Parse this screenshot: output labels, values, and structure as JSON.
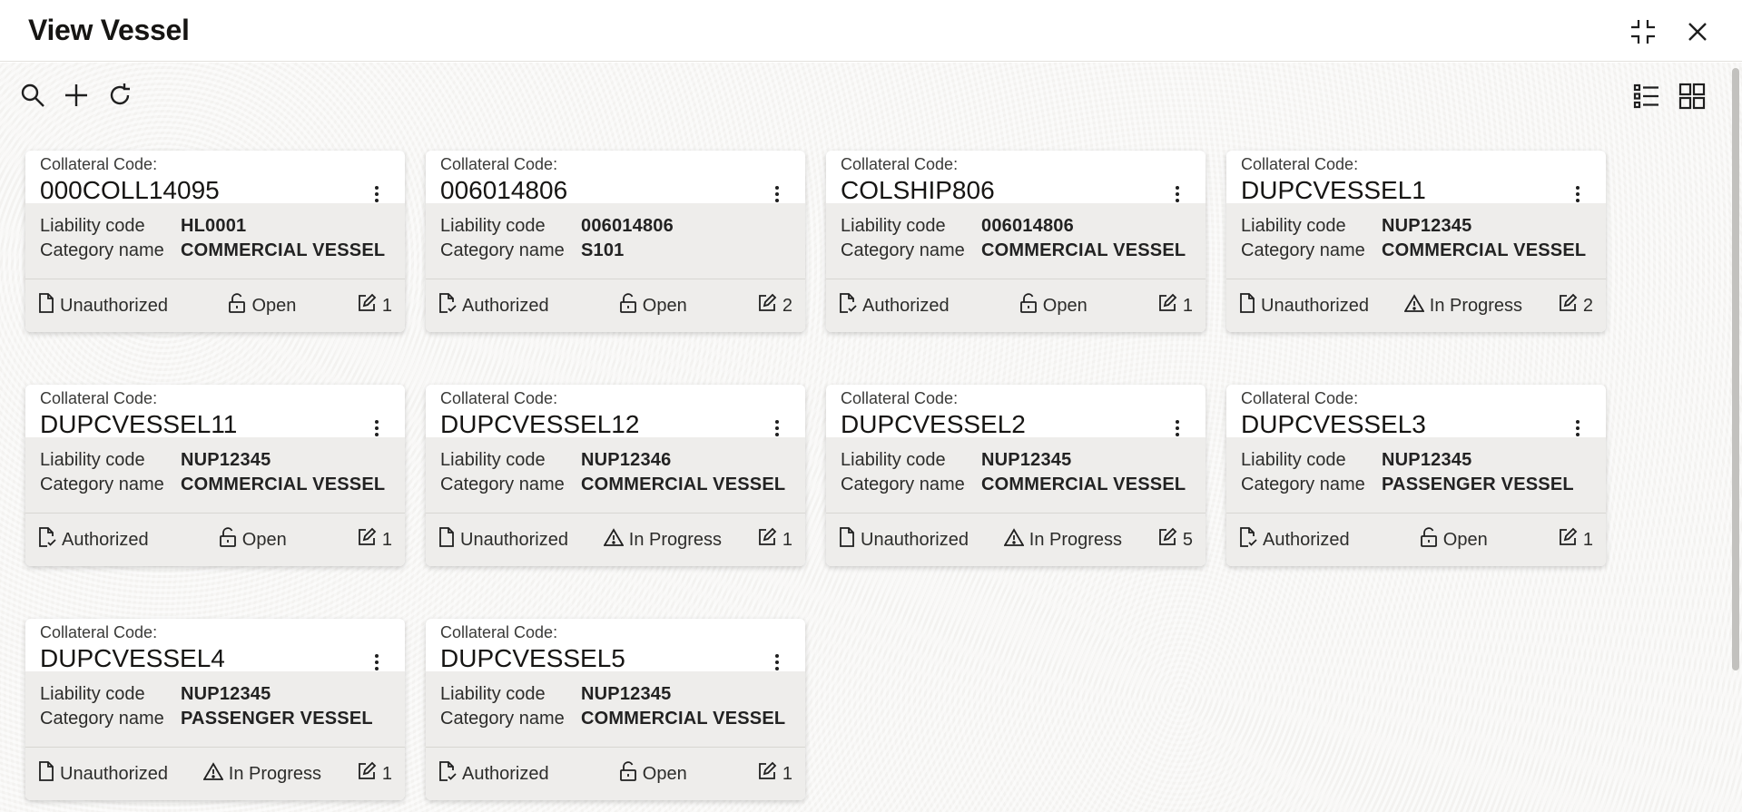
{
  "window": {
    "title": "View Vessel"
  },
  "toolbar": {
    "search": "search-icon",
    "add": "plus-icon",
    "refresh": "refresh-icon",
    "list_view": "list-view-icon",
    "grid_view": "grid-view-icon"
  },
  "labels": {
    "collateral_code": "Collateral Code:",
    "liability_code": "Liability code",
    "category_name": "Category name"
  },
  "cards": [
    {
      "code": "000COLL14095",
      "liability": "HL0001",
      "category": "COMMERCIAL VESSEL",
      "auth": "Unauthorized",
      "status": "Open",
      "mods": "1"
    },
    {
      "code": "006014806",
      "liability": "006014806",
      "category": "S101",
      "auth": "Authorized",
      "status": "Open",
      "mods": "2"
    },
    {
      "code": "COLSHIP806",
      "liability": "006014806",
      "category": "COMMERCIAL VESSEL",
      "auth": "Authorized",
      "status": "Open",
      "mods": "1"
    },
    {
      "code": "DUPCVESSEL1",
      "liability": "NUP12345",
      "category": "COMMERCIAL VESSEL",
      "auth": "Unauthorized",
      "status": "In Progress",
      "mods": "2"
    },
    {
      "code": "DUPCVESSEL11",
      "liability": "NUP12345",
      "category": "COMMERCIAL VESSEL",
      "auth": "Authorized",
      "status": "Open",
      "mods": "1"
    },
    {
      "code": "DUPCVESSEL12",
      "liability": "NUP12346",
      "category": "COMMERCIAL VESSEL",
      "auth": "Unauthorized",
      "status": "In Progress",
      "mods": "1"
    },
    {
      "code": "DUPCVESSEL2",
      "liability": "NUP12345",
      "category": "COMMERCIAL VESSEL",
      "auth": "Unauthorized",
      "status": "In Progress",
      "mods": "5"
    },
    {
      "code": "DUPCVESSEL3",
      "liability": "NUP12345",
      "category": "PASSENGER VESSEL",
      "auth": "Authorized",
      "status": "Open",
      "mods": "1"
    },
    {
      "code": "DUPCVESSEL4",
      "liability": "NUP12345",
      "category": "PASSENGER VESSEL",
      "auth": "Unauthorized",
      "status": "In Progress",
      "mods": "1"
    },
    {
      "code": "DUPCVESSEL5",
      "liability": "NUP12345",
      "category": "COMMERCIAL VESSEL",
      "auth": "Authorized",
      "status": "Open",
      "mods": "1"
    }
  ]
}
